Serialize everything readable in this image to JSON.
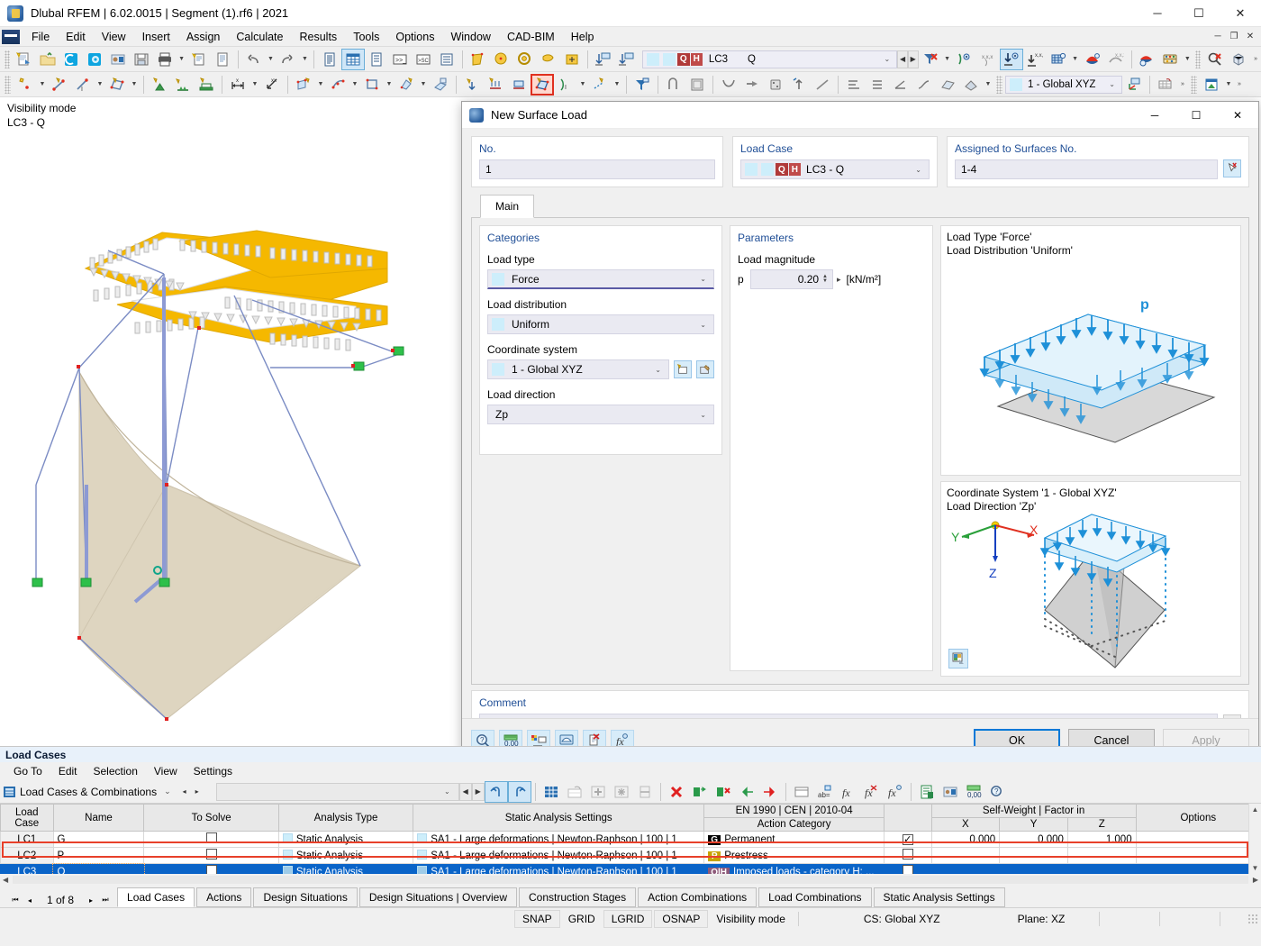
{
  "window": {
    "title": "Dlubal RFEM | 6.02.0015 | Segment (1).rf6 | 2021",
    "minimize": "─",
    "maximize": "☐",
    "close": "✕",
    "app_icon": "rfem-app-icon"
  },
  "menubar": {
    "items": [
      "File",
      "Edit",
      "View",
      "Insert",
      "Assign",
      "Calculate",
      "Results",
      "Tools",
      "Options",
      "Window",
      "CAD-BIM",
      "Help"
    ],
    "right_buttons": [
      "─",
      "❐",
      "✕"
    ]
  },
  "toolbar_load_case": {
    "label_badges": [
      "Q",
      "H"
    ],
    "code": "LC3",
    "name": "Q",
    "arrow": "⌄"
  },
  "toolbar_cs": {
    "value": "1 - Global XYZ",
    "arrow": "⌄"
  },
  "workspace": {
    "visibility_mode": "Visibility mode",
    "load_case_label": "LC3 - Q"
  },
  "dialog": {
    "title": "New Surface Load",
    "icon": "surface-load-icon",
    "minimize": "─",
    "maximize": "☐",
    "close": "✕",
    "no_group_label": "No.",
    "no_value": "1",
    "load_case_group_label": "Load Case",
    "load_case_badges": [
      "Q",
      "H"
    ],
    "load_case_value": "LC3 - Q",
    "assigned_group_label": "Assigned to Surfaces No.",
    "assigned_value": "1-4",
    "pick_icon": "pick-surfaces-icon",
    "tabs": [
      {
        "label": "Main",
        "active": true
      }
    ],
    "categories": {
      "title": "Categories",
      "load_type_label": "Load type",
      "load_type_value": "Force",
      "load_distribution_label": "Load distribution",
      "load_distribution_value": "Uniform",
      "coordinate_system_label": "Coordinate system",
      "coordinate_system_value": "1 - Global XYZ",
      "new_cs_icon": "new-coordinate-system-icon",
      "edit_cs_icon": "edit-coordinate-system-icon",
      "load_direction_label": "Load direction",
      "load_direction_value": "Zp"
    },
    "parameters": {
      "title": "Parameters",
      "magnitude_label": "Load magnitude",
      "symbol": "p",
      "value": "0.20",
      "unit": "[kN/m²]",
      "arrow": "▸"
    },
    "preview_top": {
      "line1": "Load Type 'Force'",
      "line2": "Load Distribution 'Uniform'",
      "load_symbol": "p"
    },
    "preview_bottom": {
      "line1": "Coordinate System '1 - Global XYZ'",
      "line2": "Load Direction 'Zp'",
      "axis_x": "X",
      "axis_y": "Y",
      "axis_z": "Z",
      "settings_icon": "preview-settings-icon"
    },
    "comment": {
      "label": "Comment",
      "value": "",
      "arrow": "⌄",
      "copy_icon": "comment-copy-icon"
    },
    "footer_icons": [
      "help-icon",
      "units-icon",
      "display-properties-icon",
      "visual-icon",
      "delete-icon",
      "formula-icon"
    ],
    "ok": "OK",
    "cancel": "Cancel",
    "apply": "Apply"
  },
  "bottom": {
    "title": "Load Cases",
    "menu": [
      "Go To",
      "Edit",
      "Selection",
      "View",
      "Settings"
    ],
    "selector": "Load Cases & Combinations",
    "selector_arrow": "⌄",
    "nav_prev": "◂",
    "nav_next": "▸",
    "columns": {
      "load_case": "Load\nCase",
      "name": "Name",
      "to_solve": "To Solve",
      "analysis_type": "Analysis Type",
      "static_analysis_settings": "Static Analysis Settings",
      "action_category_top": "EN 1990 | CEN | 2010-04",
      "action_category_bottom": "Action Category",
      "self_weight": "Self-Weight | Factor in",
      "x": "X",
      "y": "Y",
      "z": "Z",
      "options": "Options"
    },
    "rows": [
      {
        "load_case": "LC1",
        "name": "G",
        "to_solve": false,
        "analysis_type": "Static Analysis",
        "settings": "SA1 - Large deformations | Newton-Raphson | 100 | 1",
        "cat_badge": "G",
        "cat_badge_color": "#000000",
        "category": "Permanent",
        "sw_checked": true,
        "x": "0.000",
        "y": "0.000",
        "z": "1.000",
        "options": "",
        "selected": false
      },
      {
        "load_case": "LC2",
        "name": "P",
        "to_solve": false,
        "analysis_type": "Static Analysis",
        "settings": "SA1 - Large deformations | Newton-Raphson | 100 | 1",
        "cat_badge": "P",
        "cat_badge_color": "#c8a400",
        "category": "Prestress",
        "sw_checked": false,
        "x": "",
        "y": "",
        "z": "",
        "options": "",
        "selected": false
      },
      {
        "load_case": "LC3",
        "name": "Q",
        "to_solve": false,
        "analysis_type": "Static Analysis",
        "settings": "SA1 - Large deformations | Newton-Raphson | 100 | 1",
        "cat_badge": "Q|H",
        "cat_badge_color": "#8d5a7a",
        "category": "Imposed loads - category H: ...",
        "sw_checked": false,
        "x": "",
        "y": "",
        "z": "",
        "options": "",
        "selected": true
      }
    ],
    "pager": {
      "first": "⏮",
      "prev": "◂",
      "label": "1 of 8",
      "next": "▸",
      "last": "⏭"
    },
    "tabs": [
      {
        "label": "Load Cases",
        "active": true
      },
      {
        "label": "Actions",
        "active": false
      },
      {
        "label": "Design Situations",
        "active": false
      },
      {
        "label": "Design Situations | Overview",
        "active": false
      },
      {
        "label": "Construction Stages",
        "active": false
      },
      {
        "label": "Action Combinations",
        "active": false
      },
      {
        "label": "Load Combinations",
        "active": false
      },
      {
        "label": "Static Analysis Settings",
        "active": false
      }
    ]
  },
  "statusbar": {
    "snap": "SNAP",
    "grid": "GRID",
    "lgrid": "LGRID",
    "osnap": "OSNAP",
    "visibility": "Visibility mode",
    "cs": "CS: Global XYZ",
    "plane": "Plane: XZ"
  },
  "colors": {
    "accent": "#0078d7",
    "selection": "#0a64c8",
    "group_label": "#1f4e96",
    "red_highlight": "#e8402a",
    "preview_blue": "#1e90d8"
  }
}
